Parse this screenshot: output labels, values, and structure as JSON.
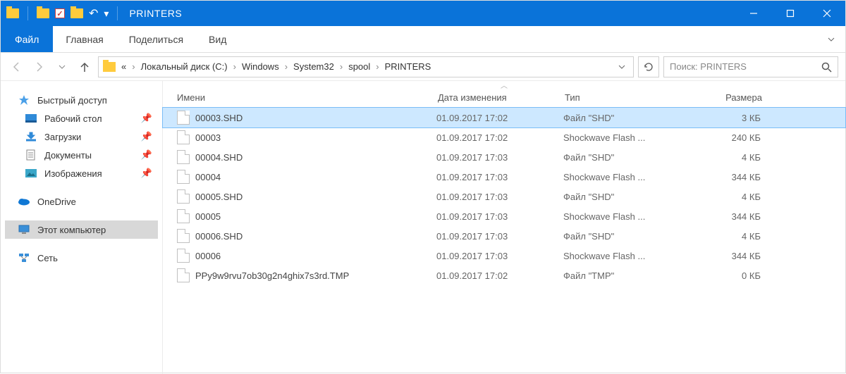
{
  "window": {
    "title": "PRINTERS"
  },
  "ribbon": {
    "file": "Файл",
    "tabs": [
      "Главная",
      "Поделиться",
      "Вид"
    ]
  },
  "breadcrumbs": [
    "«",
    "Локальный диск (C:)",
    "Windows",
    "System32",
    "spool",
    "PRINTERS"
  ],
  "search": {
    "placeholder": "Поиск: PRINTERS"
  },
  "navpane": {
    "quick_access": "Быстрый доступ",
    "items": [
      {
        "label": "Рабочий стол",
        "icon": "desktop"
      },
      {
        "label": "Загрузки",
        "icon": "downloads"
      },
      {
        "label": "Документы",
        "icon": "documents"
      },
      {
        "label": "Изображения",
        "icon": "pictures"
      }
    ],
    "onedrive": "OneDrive",
    "this_pc": "Этот компьютер",
    "network": "Сеть"
  },
  "columns": {
    "name": "Имени",
    "date": "Дата изменения",
    "type": "Тип",
    "size": "Размера"
  },
  "files": [
    {
      "name": "00003.SHD",
      "date": "01.09.2017 17:02",
      "type": "Файл \"SHD\"",
      "size": "3 КБ",
      "selected": true
    },
    {
      "name": "00003",
      "date": "01.09.2017 17:02",
      "type": "Shockwave Flash ...",
      "size": "240 КБ"
    },
    {
      "name": "00004.SHD",
      "date": "01.09.2017 17:03",
      "type": "Файл \"SHD\"",
      "size": "4 КБ"
    },
    {
      "name": "00004",
      "date": "01.09.2017 17:03",
      "type": "Shockwave Flash ...",
      "size": "344 КБ"
    },
    {
      "name": "00005.SHD",
      "date": "01.09.2017 17:03",
      "type": "Файл \"SHD\"",
      "size": "4 КБ"
    },
    {
      "name": "00005",
      "date": "01.09.2017 17:03",
      "type": "Shockwave Flash ...",
      "size": "344 КБ"
    },
    {
      "name": "00006.SHD",
      "date": "01.09.2017 17:03",
      "type": "Файл \"SHD\"",
      "size": "4 КБ"
    },
    {
      "name": "00006",
      "date": "01.09.2017 17:03",
      "type": "Shockwave Flash ...",
      "size": "344 КБ"
    },
    {
      "name": "PPy9w9rvu7ob30g2n4ghix7s3rd.TMP",
      "date": "01.09.2017 17:02",
      "type": "Файл \"TMP\"",
      "size": "0 КБ"
    }
  ]
}
